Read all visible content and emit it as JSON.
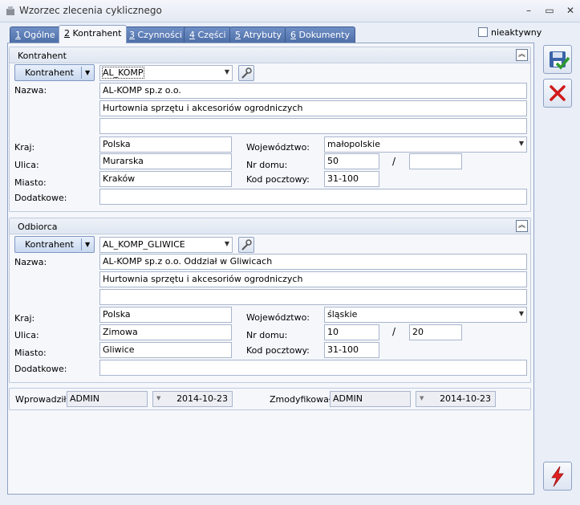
{
  "window": {
    "title": "Wzorzec zlecenia cyklicznego",
    "min": "–",
    "max": "▭",
    "close": "✕"
  },
  "tabs": [
    {
      "num": "1",
      "label": " Ogólne"
    },
    {
      "num": "2",
      "label": " Kontrahent"
    },
    {
      "num": "3",
      "label": " Czynności"
    },
    {
      "num": "4",
      "label": " Części"
    },
    {
      "num": "5",
      "label": " Atrybuty"
    },
    {
      "num": "6",
      "label": " Dokumenty"
    }
  ],
  "inactive_label": "nieaktywny",
  "labels": {
    "nazwa": "Nazwa:",
    "kraj": "Kraj:",
    "ulica": "Ulica:",
    "miasto": "Miasto:",
    "dodatkowe": "Dodatkowe:",
    "woj": "Województwo:",
    "nr": "Nr domu:",
    "kod": "Kod pocztowy:",
    "slash": "/"
  },
  "kontrahent": {
    "section_title": "Kontrahent",
    "button": "Kontrahent",
    "code": "AL_KOMP",
    "name1": "AL-KOMP sp.z o.o.",
    "name2": "Hurtownia sprzętu i akcesoriów ogrodniczych",
    "name3": "",
    "kraj": "Polska",
    "ulica": "Murarska",
    "miasto": "Kraków",
    "dodatkowe": "",
    "woj": "małopolskie",
    "nr": "50",
    "nr2": "",
    "kod": "31-100"
  },
  "odbiorca": {
    "section_title": "Odbiorca",
    "button": "Kontrahent",
    "code": "AL_KOMP_GLIWICE",
    "name1": "AL-KOMP sp.z o.o. Oddział w Gliwicach",
    "name2": "Hurtownia sprzętu i akcesoriów ogrodniczych",
    "name3": "",
    "kraj": "Polska",
    "ulica": "Zimowa",
    "miasto": "Gliwice",
    "dodatkowe": "",
    "woj": "śląskie",
    "nr": "10",
    "nr2": "20",
    "kod": "31-100"
  },
  "footer": {
    "wprowadzil_label": "Wprowadził:",
    "wprowadzil_user": "ADMIN",
    "wprowadzil_date": "2014-10-23",
    "zmodyfikowal_label": "Zmodyfikował:",
    "zmodyfikowal_user": "ADMIN",
    "zmodyfikowal_date": "2014-10-23"
  },
  "colors": {
    "tab_blue": "#5b7bb5",
    "save_green": "#2e9a2e",
    "cancel_red": "#d11a1a"
  }
}
